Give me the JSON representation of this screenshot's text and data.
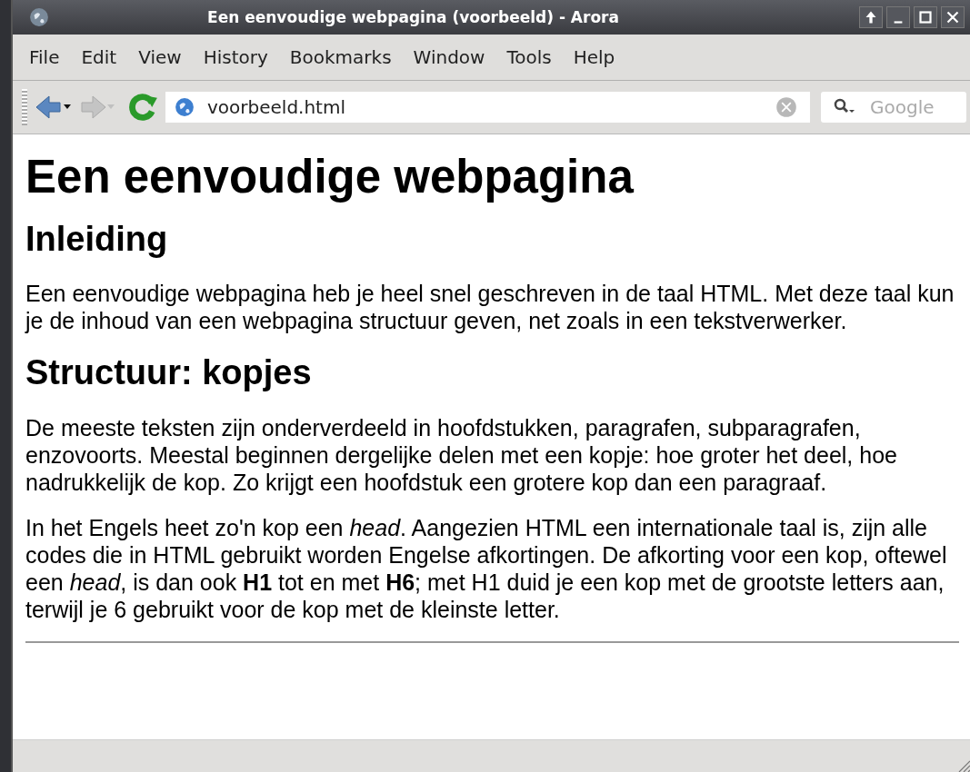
{
  "window": {
    "title": "Een eenvoudige webpagina (voorbeeld) - Arora"
  },
  "menu": [
    {
      "label": "File"
    },
    {
      "label": "Edit"
    },
    {
      "label": "View"
    },
    {
      "label": "History"
    },
    {
      "label": "Bookmarks"
    },
    {
      "label": "Window"
    },
    {
      "label": "Tools"
    },
    {
      "label": "Help"
    }
  ],
  "toolbar": {
    "back_disabled": false,
    "forward_disabled": true,
    "address": "voorbeeld.html",
    "search": {
      "placeholder": "Google"
    }
  },
  "content": [
    {
      "kind": "h1",
      "text": "Een eenvoudige webpagina"
    },
    {
      "kind": "h2",
      "text": "Inleiding"
    },
    {
      "kind": "p",
      "text": "Een eenvoudige webpagina heb je heel snel geschreven in de taal HTML. Met deze taal kun je de inhoud van een webpagina structuur geven, net zoals in een tekstverwerker."
    },
    {
      "kind": "h2",
      "text": "Structuur: kopjes"
    },
    {
      "kind": "p",
      "text": "De meeste teksten zijn onderverdeeld in hoofdstukken, paragrafen, subparagrafen, enzovoorts. Meestal beginnen dergelijke delen met een kopje: hoe groter het deel, hoe nadrukkelijk de kop. Zo krijgt een hoofdstuk een grotere kop dan een paragraaf."
    },
    {
      "kind": "p",
      "text": "In het Engels heet zo'n kop een *head*. Aangezien HTML een internationale taal is, zijn alle codes die in HTML gebruikt worden Engelse afkortingen. De afkorting voor een kop, oftewel een *head*, is dan ook **H1** tot en met **H6**; met H1 duid je een kop met de grootste letters aan, terwijl je 6 gebruikt voor de kop met de kleinste letter."
    },
    {
      "kind": "hr"
    }
  ]
}
